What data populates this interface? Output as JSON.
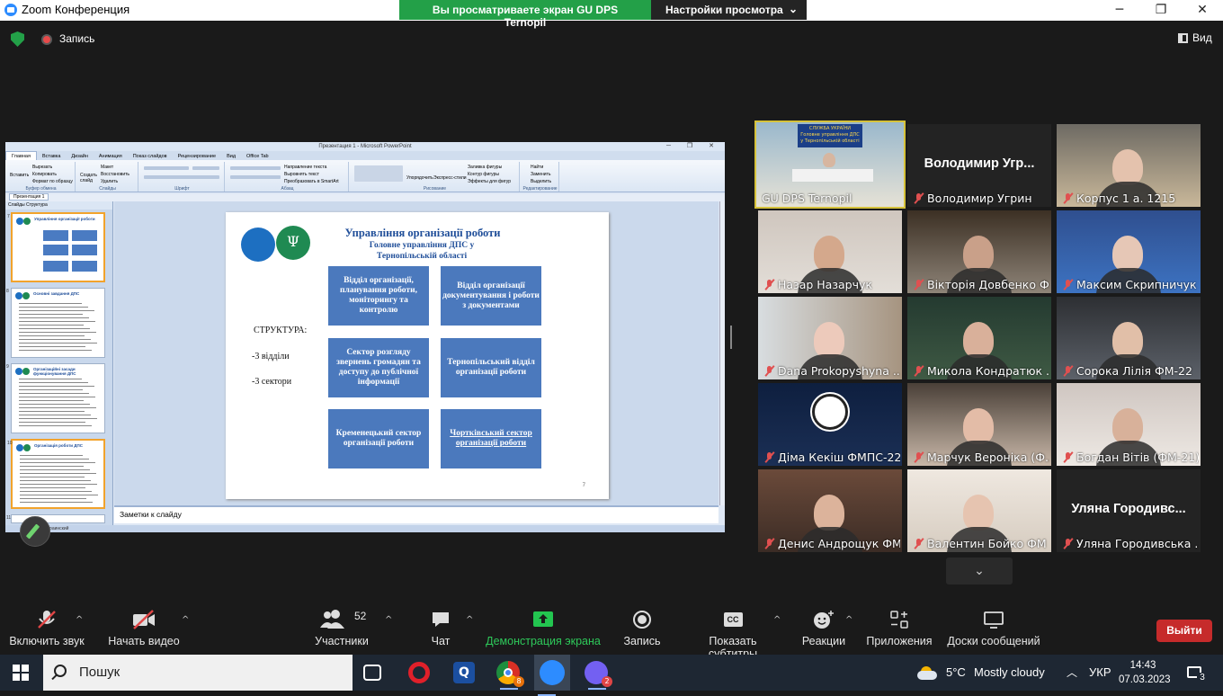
{
  "window": {
    "title": "Zoom Конференция",
    "icon": "zoom-logo-icon"
  },
  "share_banner": {
    "status": "Вы просматриваете экран GU DPS Ternopil",
    "view_options": "Настройки просмотра"
  },
  "topbar": {
    "recording": "Запись",
    "view": "Вид"
  },
  "powerpoint": {
    "title": "Презентация 1 - Microsoft PowerPoint",
    "tabs": [
      "Главная",
      "Вставка",
      "Дизайн",
      "Анимация",
      "Показ слайдов",
      "Рецензирование",
      "Вид",
      "Office Tab"
    ],
    "doc_tab": "Презентация 1",
    "pane_tabs": "Слайды  Структура",
    "ribbon_groups": [
      "Буфер обмена",
      "Слайды",
      "Шрифт",
      "Абзац",
      "Рисование",
      "Редактирование"
    ],
    "ribbon_items": {
      "clipboard": [
        "Вырезать",
        "Копировать",
        "Формат по образцу"
      ],
      "paste": "Вставить",
      "slides": [
        "Макет",
        "Восстановить",
        "Удалить"
      ],
      "create_slide": "Создать слайд",
      "paragraph": [
        "Направление текста",
        "Выровнять текст",
        "Преобразовать в SmartArt"
      ],
      "arrange": "Упорядочить",
      "quick_styles": "Экспресс-стили",
      "shape_format": [
        "Заливка фигуры",
        "Контур фигуры",
        "Эффекты для фигур"
      ],
      "editing": [
        "Найти",
        "Заменить",
        "Выделить"
      ]
    },
    "notes_placeholder": "Заметки к слайду",
    "status": "Office  украинский",
    "slide": {
      "title": "Управління організації роботи",
      "subtitle": "Головне управління ДПС у Тернопільській області",
      "structure_label": "СТРУКТУРА:",
      "count_1": "-3 відділи",
      "count_2": "-3 сектори",
      "boxes": [
        "Відділ організації, планування роботи, моніторингу та контролю",
        "Відділ організації документування і роботи з документами",
        "Сектор розгляду звернень громадян та доступу до публічної інформації",
        "Тернопільський відділ організації роботи",
        "Кременецький сектор організації роботи",
        "Чортківський сектор організації роботи"
      ],
      "page_number": "7"
    },
    "thumbnails": [
      {
        "num": "7",
        "title": "Управління організації роботи"
      },
      {
        "num": "8",
        "title": "Основні завдання ДПС"
      },
      {
        "num": "9",
        "title": "Організаційні засади функціонування ДПС"
      },
      {
        "num": "10",
        "title": "Організація роботи ДПС"
      },
      {
        "num": "11",
        "title": ""
      }
    ]
  },
  "participants": [
    {
      "name": "GU DPS Ternopil",
      "muted": false,
      "video": true,
      "active": true
    },
    {
      "name": "Володимир Угрин",
      "big_label": "Володимир Угр...",
      "muted": true,
      "video": false
    },
    {
      "name": "Корпус 1 а. 1215",
      "muted": true,
      "video": true
    },
    {
      "name": "Назар Назарчук",
      "muted": true,
      "video": true
    },
    {
      "name": "Вікторія Довбенко Ф...",
      "muted": true,
      "video": true
    },
    {
      "name": "Максим Скрипничук ...",
      "muted": true,
      "video": true
    },
    {
      "name": "Dana Prokopyshyna ...",
      "muted": true,
      "video": true
    },
    {
      "name": "Микола Кондратюк ...",
      "muted": true,
      "video": true
    },
    {
      "name": "Сорока Лілія ФМ-22",
      "muted": true,
      "video": true
    },
    {
      "name": "Діма Кекіш ФМПС-22",
      "muted": true,
      "video": true
    },
    {
      "name": "Марчук Вероніка (Ф...",
      "muted": true,
      "video": true
    },
    {
      "name": "Богдан Вітів (ФМ-21)",
      "muted": true,
      "video": true
    },
    {
      "name": "Денис Андрощук ФМ...",
      "muted": true,
      "video": true
    },
    {
      "name": "Валентин Бойко ФМ ...",
      "muted": true,
      "video": true
    },
    {
      "name": "Уляна Городивська ...",
      "big_label": "Уляна  Городивс...",
      "muted": true,
      "video": false
    }
  ],
  "controls": {
    "unmute": "Включить звук",
    "start_video": "Начать видео",
    "participants": "Участники",
    "participants_count": "52",
    "chat": "Чат",
    "share_screen": "Демонстрация экрана",
    "record": "Запись",
    "captions": "Показать субтитры",
    "captions_badge": "CC",
    "reactions": "Реакции",
    "apps": "Приложения",
    "whiteboards": "Доски сообщений",
    "leave": "Выйти"
  },
  "taskbar": {
    "search_placeholder": "Пошук",
    "weather_temp": "5°C",
    "weather_desc": "Mostly cloudy",
    "language": "УКР",
    "time": "14:43",
    "date": "07.03.2023",
    "notifications": "3",
    "chrome_badge": "8",
    "viber_badge": "2"
  },
  "colors": {
    "share_green": "#23a048",
    "leave_red": "#c62b2b",
    "active_speaker": "#d6c23a",
    "slide_box": "#4b79bd",
    "slide_title": "#1f4e99"
  }
}
